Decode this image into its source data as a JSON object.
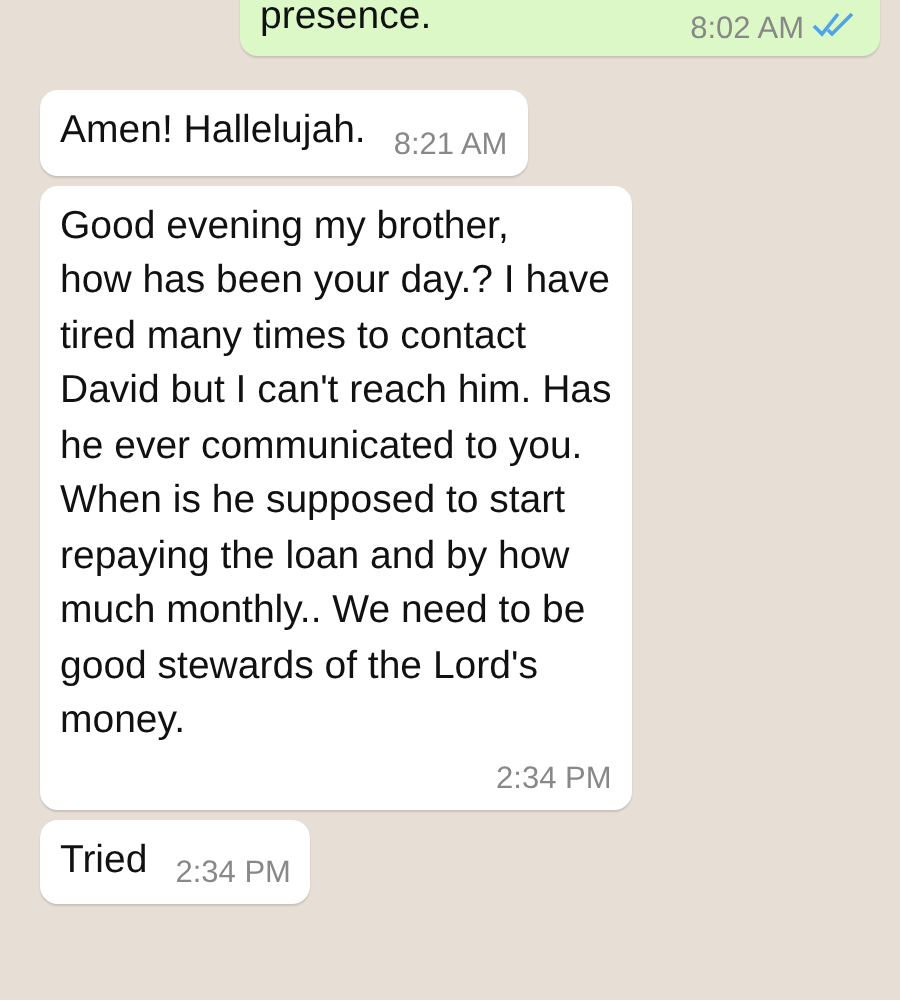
{
  "messages": [
    {
      "kind": "outgoing",
      "lines": [
        "presence."
      ],
      "time": "8:02 AM",
      "read": true
    },
    {
      "kind": "incoming",
      "lines": [
        "Amen! Hallelujah."
      ],
      "time": "8:21 AM"
    },
    {
      "kind": "incoming",
      "lines": [
        "Good evening my brother,",
        "how has been your day.? I have",
        "tired many times to contact",
        "David but I can't reach him. Has",
        "he ever communicated to you.",
        "When is he supposed to start",
        "repaying the loan and by how",
        "much monthly.. We need to be",
        "good stewards of the Lord's",
        "money."
      ],
      "time": "2:34 PM"
    },
    {
      "kind": "incoming",
      "lines": [
        "Tried"
      ],
      "time": "2:34 PM"
    }
  ]
}
